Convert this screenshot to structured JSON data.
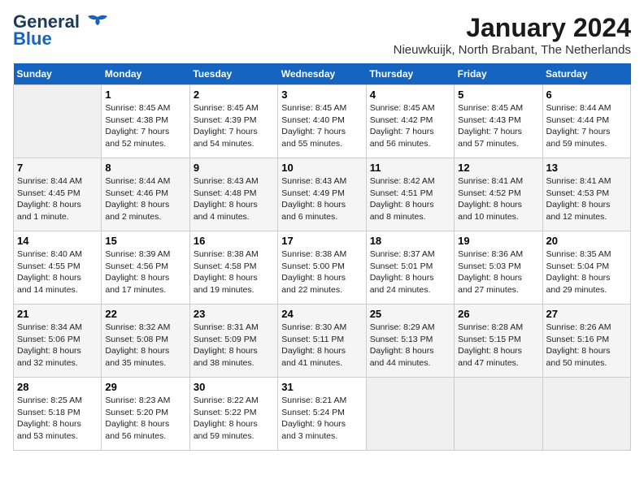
{
  "logo": {
    "line1": "General",
    "line2": "Blue"
  },
  "title": "January 2024",
  "subtitle": "Nieuwkuijk, North Brabant, The Netherlands",
  "days_of_week": [
    "Sunday",
    "Monday",
    "Tuesday",
    "Wednesday",
    "Thursday",
    "Friday",
    "Saturday"
  ],
  "weeks": [
    [
      {
        "day": "",
        "info": ""
      },
      {
        "day": "1",
        "info": "Sunrise: 8:45 AM\nSunset: 4:38 PM\nDaylight: 7 hours\nand 52 minutes."
      },
      {
        "day": "2",
        "info": "Sunrise: 8:45 AM\nSunset: 4:39 PM\nDaylight: 7 hours\nand 54 minutes."
      },
      {
        "day": "3",
        "info": "Sunrise: 8:45 AM\nSunset: 4:40 PM\nDaylight: 7 hours\nand 55 minutes."
      },
      {
        "day": "4",
        "info": "Sunrise: 8:45 AM\nSunset: 4:42 PM\nDaylight: 7 hours\nand 56 minutes."
      },
      {
        "day": "5",
        "info": "Sunrise: 8:45 AM\nSunset: 4:43 PM\nDaylight: 7 hours\nand 57 minutes."
      },
      {
        "day": "6",
        "info": "Sunrise: 8:44 AM\nSunset: 4:44 PM\nDaylight: 7 hours\nand 59 minutes."
      }
    ],
    [
      {
        "day": "7",
        "info": "Sunrise: 8:44 AM\nSunset: 4:45 PM\nDaylight: 8 hours\nand 1 minute."
      },
      {
        "day": "8",
        "info": "Sunrise: 8:44 AM\nSunset: 4:46 PM\nDaylight: 8 hours\nand 2 minutes."
      },
      {
        "day": "9",
        "info": "Sunrise: 8:43 AM\nSunset: 4:48 PM\nDaylight: 8 hours\nand 4 minutes."
      },
      {
        "day": "10",
        "info": "Sunrise: 8:43 AM\nSunset: 4:49 PM\nDaylight: 8 hours\nand 6 minutes."
      },
      {
        "day": "11",
        "info": "Sunrise: 8:42 AM\nSunset: 4:51 PM\nDaylight: 8 hours\nand 8 minutes."
      },
      {
        "day": "12",
        "info": "Sunrise: 8:41 AM\nSunset: 4:52 PM\nDaylight: 8 hours\nand 10 minutes."
      },
      {
        "day": "13",
        "info": "Sunrise: 8:41 AM\nSunset: 4:53 PM\nDaylight: 8 hours\nand 12 minutes."
      }
    ],
    [
      {
        "day": "14",
        "info": "Sunrise: 8:40 AM\nSunset: 4:55 PM\nDaylight: 8 hours\nand 14 minutes."
      },
      {
        "day": "15",
        "info": "Sunrise: 8:39 AM\nSunset: 4:56 PM\nDaylight: 8 hours\nand 17 minutes."
      },
      {
        "day": "16",
        "info": "Sunrise: 8:38 AM\nSunset: 4:58 PM\nDaylight: 8 hours\nand 19 minutes."
      },
      {
        "day": "17",
        "info": "Sunrise: 8:38 AM\nSunset: 5:00 PM\nDaylight: 8 hours\nand 22 minutes."
      },
      {
        "day": "18",
        "info": "Sunrise: 8:37 AM\nSunset: 5:01 PM\nDaylight: 8 hours\nand 24 minutes."
      },
      {
        "day": "19",
        "info": "Sunrise: 8:36 AM\nSunset: 5:03 PM\nDaylight: 8 hours\nand 27 minutes."
      },
      {
        "day": "20",
        "info": "Sunrise: 8:35 AM\nSunset: 5:04 PM\nDaylight: 8 hours\nand 29 minutes."
      }
    ],
    [
      {
        "day": "21",
        "info": "Sunrise: 8:34 AM\nSunset: 5:06 PM\nDaylight: 8 hours\nand 32 minutes."
      },
      {
        "day": "22",
        "info": "Sunrise: 8:32 AM\nSunset: 5:08 PM\nDaylight: 8 hours\nand 35 minutes."
      },
      {
        "day": "23",
        "info": "Sunrise: 8:31 AM\nSunset: 5:09 PM\nDaylight: 8 hours\nand 38 minutes."
      },
      {
        "day": "24",
        "info": "Sunrise: 8:30 AM\nSunset: 5:11 PM\nDaylight: 8 hours\nand 41 minutes."
      },
      {
        "day": "25",
        "info": "Sunrise: 8:29 AM\nSunset: 5:13 PM\nDaylight: 8 hours\nand 44 minutes."
      },
      {
        "day": "26",
        "info": "Sunrise: 8:28 AM\nSunset: 5:15 PM\nDaylight: 8 hours\nand 47 minutes."
      },
      {
        "day": "27",
        "info": "Sunrise: 8:26 AM\nSunset: 5:16 PM\nDaylight: 8 hours\nand 50 minutes."
      }
    ],
    [
      {
        "day": "28",
        "info": "Sunrise: 8:25 AM\nSunset: 5:18 PM\nDaylight: 8 hours\nand 53 minutes."
      },
      {
        "day": "29",
        "info": "Sunrise: 8:23 AM\nSunset: 5:20 PM\nDaylight: 8 hours\nand 56 minutes."
      },
      {
        "day": "30",
        "info": "Sunrise: 8:22 AM\nSunset: 5:22 PM\nDaylight: 8 hours\nand 59 minutes."
      },
      {
        "day": "31",
        "info": "Sunrise: 8:21 AM\nSunset: 5:24 PM\nDaylight: 9 hours\nand 3 minutes."
      },
      {
        "day": "",
        "info": ""
      },
      {
        "day": "",
        "info": ""
      },
      {
        "day": "",
        "info": ""
      }
    ]
  ]
}
